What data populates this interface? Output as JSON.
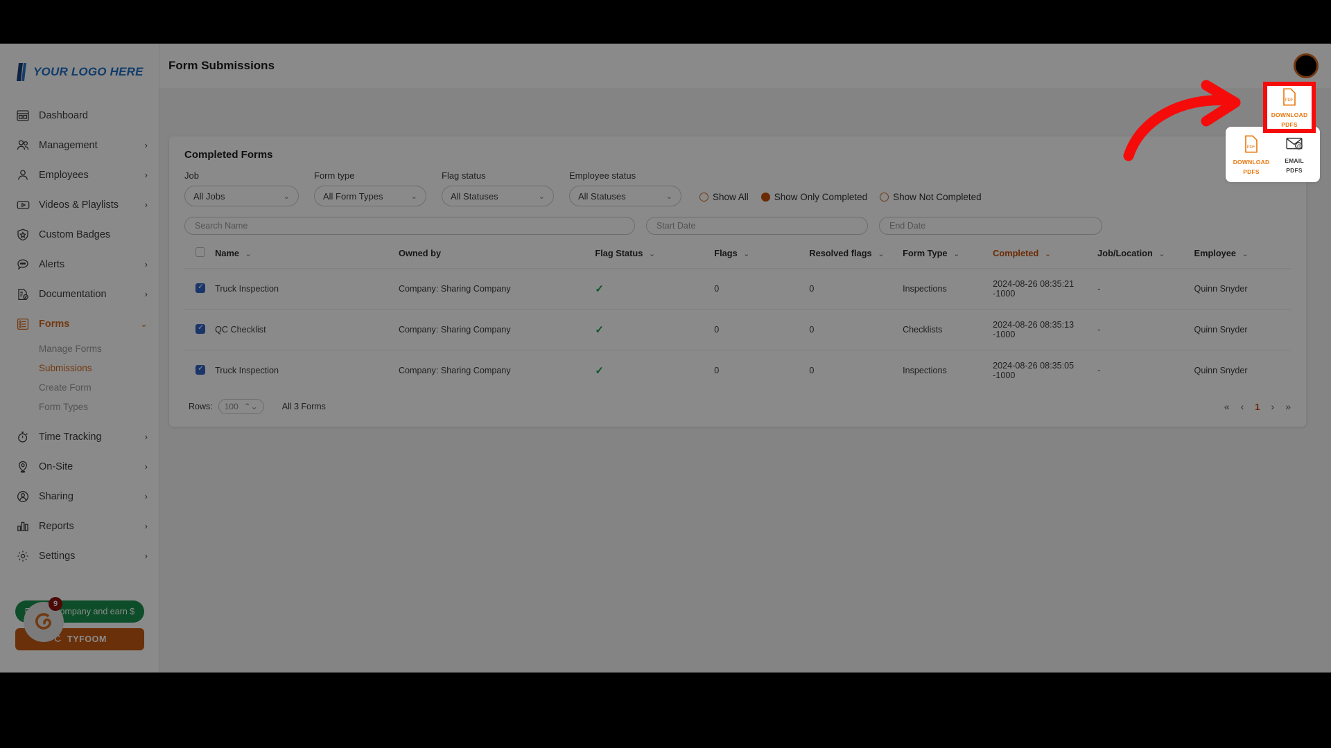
{
  "brand": {
    "logo_text": "YOUR LOGO HERE",
    "accent": "#d2691e",
    "link_blue": "#1f6fc4"
  },
  "topbar": {
    "title": "Form Submissions",
    "avatar_name": "user-avatar"
  },
  "sidebar": {
    "items": [
      {
        "label": "Dashboard",
        "icon": "dashboard-icon",
        "chevron": "",
        "active": false
      },
      {
        "label": "Management",
        "icon": "people-icon",
        "chevron": "›",
        "active": false
      },
      {
        "label": "Employees",
        "icon": "person-icon",
        "chevron": "›",
        "active": false
      },
      {
        "label": "Videos & Playlists",
        "icon": "video-icon",
        "chevron": "›",
        "active": false
      },
      {
        "label": "Custom Badges",
        "icon": "badge-icon",
        "chevron": "",
        "active": false
      },
      {
        "label": "Alerts",
        "icon": "alert-bubble-icon",
        "chevron": "›",
        "active": false
      },
      {
        "label": "Documentation",
        "icon": "document-icon",
        "chevron": "›",
        "active": false
      },
      {
        "label": "Forms",
        "icon": "forms-icon",
        "chevron": "⌄",
        "active": true
      }
    ],
    "sub_items": [
      {
        "label": "Manage Forms",
        "active": false
      },
      {
        "label": "Submissions",
        "active": true
      },
      {
        "label": "Create Form",
        "active": false
      },
      {
        "label": "Form Types",
        "active": false
      }
    ],
    "items_after": [
      {
        "label": "Time Tracking",
        "icon": "stopwatch-icon",
        "chevron": "›",
        "active": false
      },
      {
        "label": "On-Site",
        "icon": "pin-icon",
        "chevron": "›",
        "active": false
      },
      {
        "label": "Sharing",
        "icon": "share-user-icon",
        "chevron": "›",
        "active": false
      },
      {
        "label": "Reports",
        "icon": "bar-chart-icon",
        "chevron": "›",
        "active": false
      },
      {
        "label": "Settings",
        "icon": "gear-icon",
        "chevron": "›",
        "active": false
      }
    ],
    "promo": {
      "green_label": "Refer a company and earn $",
      "orange_label": "TYFOOM",
      "badge_count": "9"
    }
  },
  "card": {
    "title": "Completed Forms",
    "filters": [
      {
        "name": "job",
        "label": "Job",
        "value": "All Jobs"
      },
      {
        "name": "form-type",
        "label": "Form type",
        "value": "All Form Types"
      },
      {
        "name": "flag-status",
        "label": "Flag status",
        "value": "All Statuses"
      },
      {
        "name": "employee-status",
        "label": "Employee status",
        "value": "All Statuses"
      }
    ],
    "radios": [
      {
        "label": "Show All",
        "checked": false
      },
      {
        "label": "Show Only Completed",
        "checked": true
      },
      {
        "label": "Show Not Completed",
        "checked": false
      }
    ],
    "search_placeholder": "Search Name",
    "search_value": "",
    "start_date_placeholder": "Start Date",
    "start_date_value": "",
    "end_date_placeholder": "End Date",
    "end_date_value": "",
    "table": {
      "columns": [
        {
          "label": "Name",
          "sortable": true,
          "sorted": false
        },
        {
          "label": "Owned by",
          "sortable": false,
          "sorted": false
        },
        {
          "label": "Flag Status",
          "sortable": true,
          "sorted": false
        },
        {
          "label": "Flags",
          "sortable": true,
          "sorted": false
        },
        {
          "label": "Resolved flags",
          "sortable": true,
          "sorted": false
        },
        {
          "label": "Form Type",
          "sortable": true,
          "sorted": false
        },
        {
          "label": "Completed",
          "sortable": true,
          "sorted": true
        },
        {
          "label": "Job/Location",
          "sortable": true,
          "sorted": false
        },
        {
          "label": "Employee",
          "sortable": true,
          "sorted": false
        }
      ],
      "header_checkbox_checked": false,
      "rows": [
        {
          "checked": true,
          "name": "Truck Inspection",
          "owned_by": "Company: Sharing Company",
          "flag_status": "✓",
          "flags": "0",
          "resolved_flags": "0",
          "form_type": "Inspections",
          "completed": "2024-08-26 08:35:21 -1000",
          "job_location": "-",
          "employee": "Quinn Snyder"
        },
        {
          "checked": true,
          "name": "QC Checklist",
          "owned_by": "Company: Sharing Company",
          "flag_status": "✓",
          "flags": "0",
          "resolved_flags": "0",
          "form_type": "Checklists",
          "completed": "2024-08-26 08:35:13 -1000",
          "job_location": "-",
          "employee": "Quinn Snyder"
        },
        {
          "checked": true,
          "name": "Truck Inspection",
          "owned_by": "Company: Sharing Company",
          "flag_status": "✓",
          "flags": "0",
          "resolved_flags": "0",
          "form_type": "Inspections",
          "completed": "2024-08-26 08:35:05 -1000",
          "job_location": "-",
          "employee": "Quinn Snyder"
        }
      ]
    },
    "footer": {
      "rows_label": "Rows:",
      "rows_value": "100",
      "count_label": "All 3 Forms",
      "pager": {
        "first": "«",
        "prev": "‹",
        "current": "1",
        "next": "›",
        "last": "»"
      }
    }
  },
  "actions": {
    "download": {
      "line1": "DOWNLOAD",
      "line2": "PDFS",
      "icon_caption": "PDF",
      "icon": "pdf-file-icon"
    },
    "email": {
      "line1": "EMAIL",
      "line2": "PDFS",
      "icon": "email-at-icon"
    }
  },
  "annotation": {
    "highlight_color": "#f60b0b",
    "arrow_name": "red-curved-arrow",
    "target": "download-pdfs-button"
  }
}
